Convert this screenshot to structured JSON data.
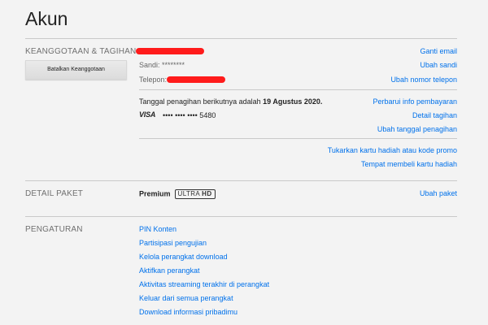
{
  "page": {
    "title": "Akun"
  },
  "membership": {
    "section_title": "KEANGGOTAAN & TAGIHAN",
    "cancel_button_label": "Batalkan Keanggotaan",
    "password_label": "Sandi: ********",
    "phone_label": "Telepon:",
    "billing_prefix": "Tanggal penagihan berikutnya adalah",
    "billing_date": "19 Agustus 2020.",
    "card_brand": "VISA",
    "card_number": "•••• •••• •••• 5480",
    "links": {
      "change_email": "Ganti email",
      "change_password": "Ubah sandi",
      "change_phone": "Ubah nomor telepon",
      "update_payment": "Perbarui info pembayaran",
      "billing_details": "Detail tagihan",
      "change_billing_date": "Ubah tanggal penagihan",
      "redeem_gift": "Tukarkan kartu hadiah atau kode promo",
      "buy_gift": "Tempat membeli kartu hadiah"
    },
    "redaction_color": "#ff1b1b"
  },
  "plan": {
    "section_title": "DETAIL PAKET",
    "plan_name": "Premium",
    "badge_ultra": "ULTRA",
    "badge_hd": "HD",
    "change_plan": "Ubah paket"
  },
  "settings": {
    "section_title": "PENGATURAN",
    "items": [
      {
        "label": "PIN Konten"
      },
      {
        "label": "Partisipasi pengujian"
      },
      {
        "label": "Kelola perangkat download"
      },
      {
        "label": "Aktifkan perangkat"
      },
      {
        "label": "Aktivitas streaming terakhir di perangkat"
      },
      {
        "label": "Keluar dari semua perangkat"
      },
      {
        "label": "Download informasi pribadimu"
      }
    ]
  },
  "colors": {
    "link": "#0071eb",
    "background": "#f3f3f3",
    "section_label": "#707070"
  }
}
